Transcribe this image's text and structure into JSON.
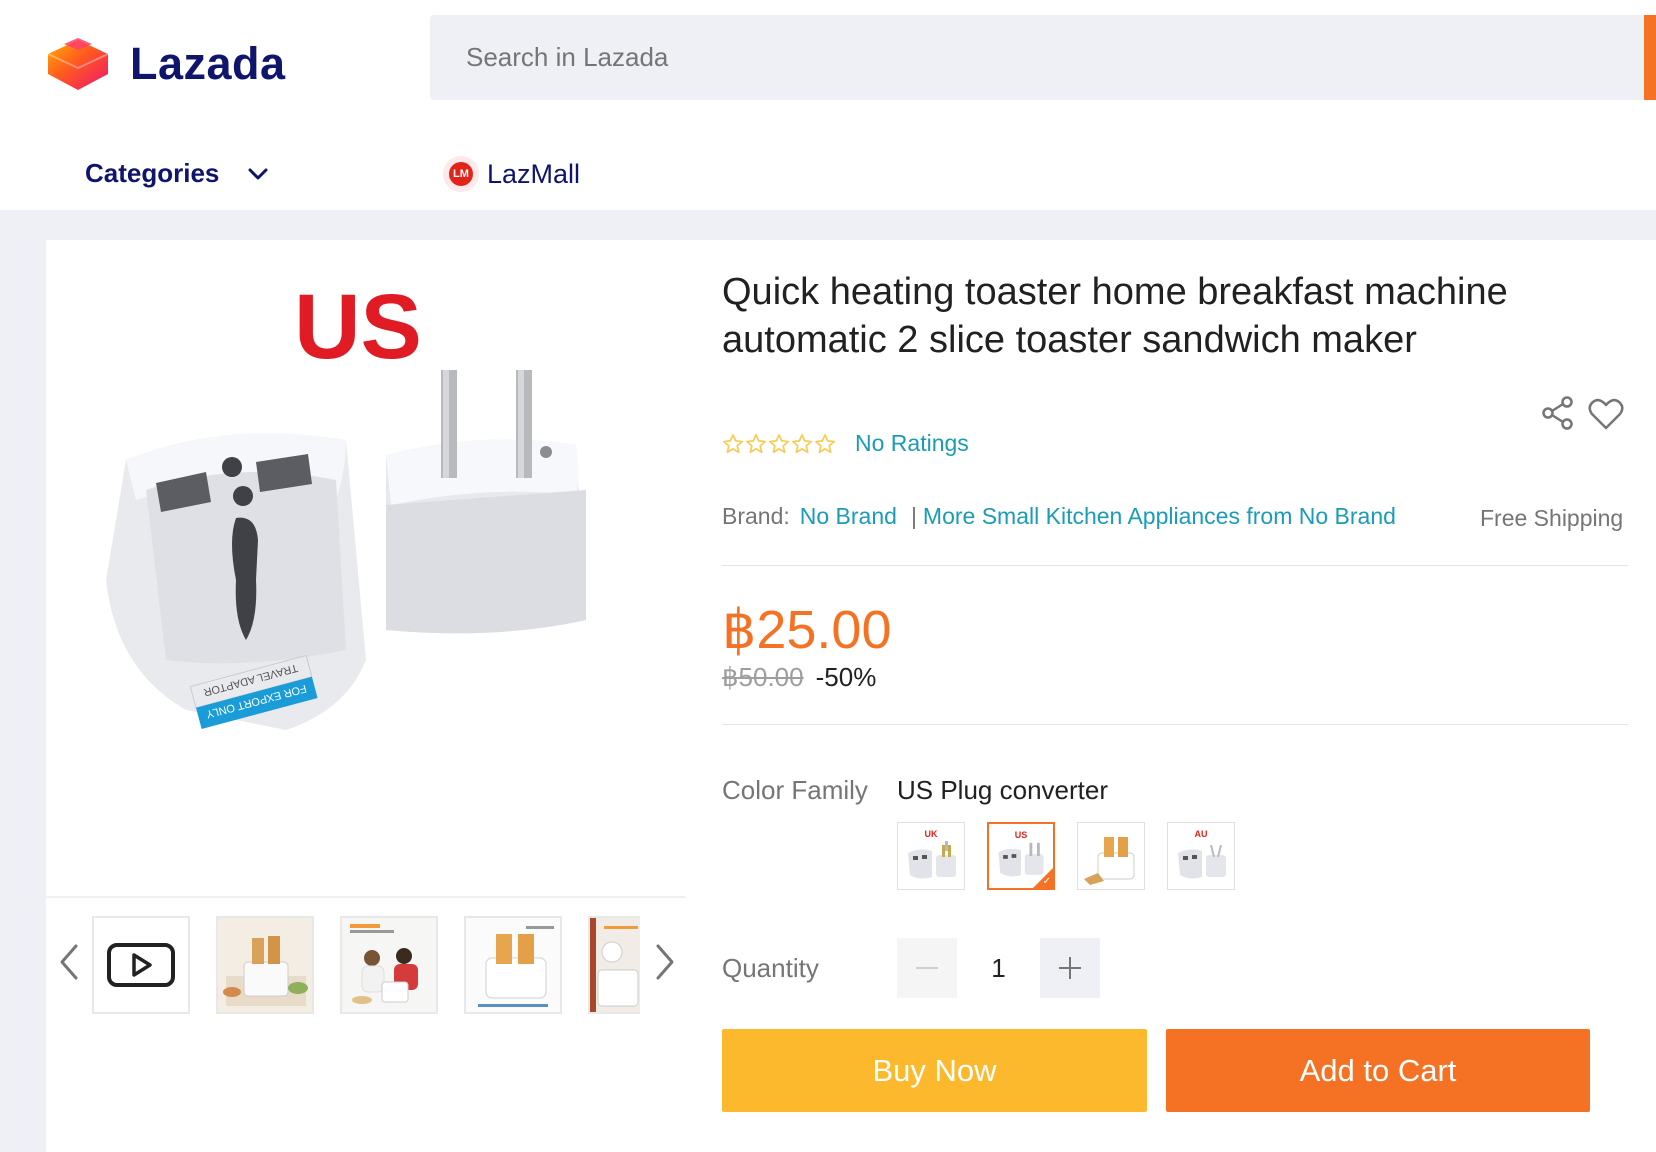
{
  "header": {
    "logo_text": "Lazada",
    "search_placeholder": "Search in Lazada",
    "nav": {
      "categories_label": "Categories",
      "lazmall_label": "LazMall",
      "lazmall_badge": "LM"
    }
  },
  "gallery": {
    "main_image_caption": "US",
    "adapter_label_line1": "TRAVEL ADAPTOR",
    "adapter_label_line2": "FOR EXPORT ONLY",
    "thumbnails": [
      "video",
      "toaster-with-toast",
      "people-with-toaster",
      "toaster-white",
      "toaster-partial"
    ]
  },
  "product": {
    "title": "Quick heating toaster home breakfast machine automatic 2 slice toaster sandwich maker",
    "ratings_text": "No Ratings",
    "star_count": 5,
    "brand_label": "Brand:",
    "brand_value": "No Brand",
    "brand_separator": "|",
    "more_from_brand": "More Small Kitchen Appliances from No Brand",
    "free_shipping": "Free Shipping",
    "price": "฿25.00",
    "old_price": "฿50.00",
    "discount": "-50%",
    "color_family_label": "Color Family",
    "color_family_value": "US Plug converter",
    "color_options": [
      {
        "tag": "UK",
        "selected": false
      },
      {
        "tag": "US",
        "selected": true
      },
      {
        "tag": "",
        "selected": false
      },
      {
        "tag": "AU",
        "selected": false
      }
    ],
    "quantity_label": "Quantity",
    "quantity_value": "1",
    "buy_now_label": "Buy Now",
    "add_to_cart_label": "Add to Cart"
  },
  "colors": {
    "brand_orange": "#f57224",
    "buy_yellow": "#fcb92d",
    "link_teal": "#1a9cb7",
    "nav_navy": "#0f146d"
  },
  "icons": [
    "lazada-logo-icon",
    "chevron-down-icon",
    "lazmall-icon",
    "share-icon",
    "heart-icon",
    "star-outline-icon",
    "play-icon",
    "chevron-left-icon",
    "chevron-right-icon",
    "minus-icon",
    "plus-icon"
  ]
}
